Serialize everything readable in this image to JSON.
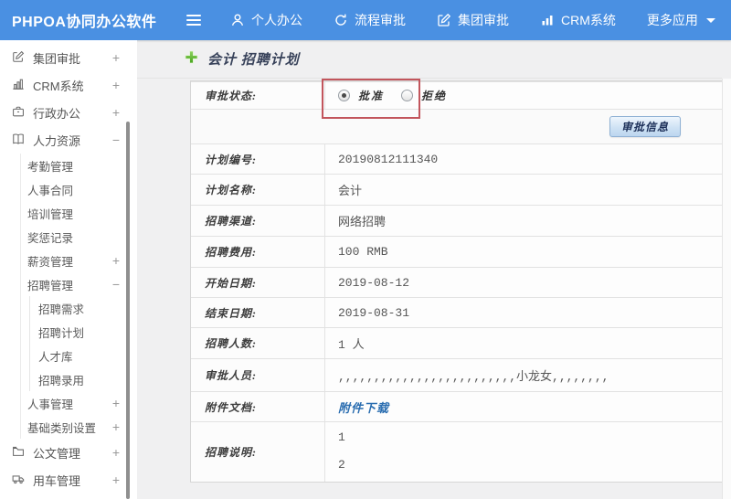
{
  "topbar": {
    "logo": "PHPOA协同办公软件",
    "menu": [
      {
        "label": "个人办公",
        "icon": "user-icon"
      },
      {
        "label": "流程审批",
        "icon": "cycle-icon"
      },
      {
        "label": "集团审批",
        "icon": "edit-icon"
      },
      {
        "label": "CRM系统",
        "icon": "chart-icon"
      },
      {
        "label": "更多应用",
        "icon": "caret-down-icon"
      }
    ]
  },
  "sidebar": {
    "items": [
      {
        "label": "集团审批",
        "icon": "edit-icon",
        "toggle": "+",
        "level": 1
      },
      {
        "label": "CRM系统",
        "icon": "chart-icon",
        "toggle": "+",
        "level": 1
      },
      {
        "label": "行政办公",
        "icon": "briefcase-icon",
        "toggle": "+",
        "level": 1
      },
      {
        "label": "人力资源",
        "icon": "book-icon",
        "toggle": "−",
        "level": 1
      },
      {
        "label": "考勤管理",
        "level": 2
      },
      {
        "label": "人事合同",
        "level": 2
      },
      {
        "label": "培训管理",
        "level": 2
      },
      {
        "label": "奖惩记录",
        "level": 2
      },
      {
        "label": "薪资管理",
        "toggle": "+",
        "level": 2
      },
      {
        "label": "招聘管理",
        "toggle": "−",
        "level": 2
      },
      {
        "label": "招聘需求",
        "level": 3
      },
      {
        "label": "招聘计划",
        "level": 3
      },
      {
        "label": "人才库",
        "level": 3
      },
      {
        "label": "招聘录用",
        "level": 3
      },
      {
        "label": "人事管理",
        "toggle": "+",
        "level": 2
      },
      {
        "label": "基础类别设置",
        "toggle": "+",
        "level": 2
      },
      {
        "label": "公文管理",
        "icon": "folder-icon",
        "toggle": "+",
        "level": 1
      },
      {
        "label": "用车管理",
        "icon": "truck-icon",
        "toggle": "+",
        "level": 1
      }
    ]
  },
  "breadcrumb": {
    "title": "会计 招聘计划"
  },
  "form": {
    "status": {
      "label": "审批状态:",
      "options": [
        "批准",
        "拒绝"
      ],
      "selected": "批准"
    },
    "approve_button": "审批信息",
    "rows": [
      {
        "label": "计划编号:",
        "value": "20190812111340"
      },
      {
        "label": "计划名称:",
        "value": "会计"
      },
      {
        "label": "招聘渠道:",
        "value": "网络招聘"
      },
      {
        "label": "招聘费用:",
        "value": "100 RMB"
      },
      {
        "label": "开始日期:",
        "value": "2019-08-12"
      },
      {
        "label": "结束日期:",
        "value": "2019-08-31"
      },
      {
        "label": "招聘人数:",
        "value": "1 人"
      },
      {
        "label": "审批人员:",
        "value": ",,,,,,,,,,,,,,,,,,,,,,,,,小龙女,,,,,,,,"
      },
      {
        "label": "附件文档:",
        "value": "附件下载"
      },
      {
        "label": "招聘说明:",
        "value": "1",
        "value2": "2"
      }
    ]
  },
  "colors": {
    "topbar_blue": "#4a90e2",
    "annotation_red": "#c2555c",
    "link_blue": "#2a6db0",
    "plus_green": "#54b327"
  }
}
